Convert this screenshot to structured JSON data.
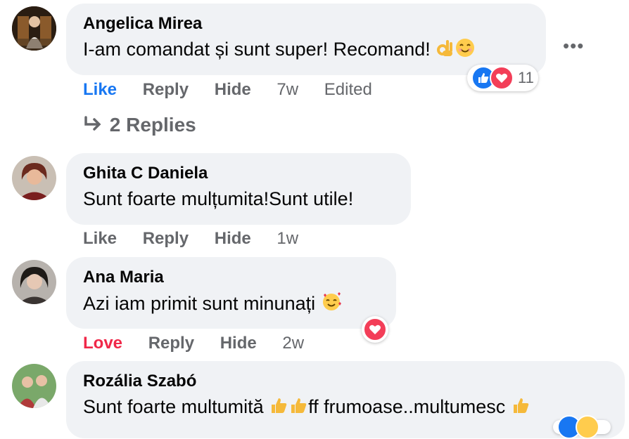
{
  "more_label": "•••",
  "comments": [
    {
      "author": "Angelica Mirea",
      "text": "I-am comandat și sunt super! Recomand!",
      "like": "Like",
      "reply": "Reply",
      "hide": "Hide",
      "time": "7w",
      "edited": "Edited",
      "reaction_count": "11",
      "replies_label": "2 Replies"
    },
    {
      "author": "Ghita C Daniela",
      "text": "Sunt foarte mulțumita!Sunt utile!",
      "like": "Like",
      "reply": "Reply",
      "hide": "Hide",
      "time": "1w"
    },
    {
      "author": "Ana Maria",
      "text": "Azi iam primit sunt minunați",
      "like": "Love",
      "reply": "Reply",
      "hide": "Hide",
      "time": "2w"
    },
    {
      "author": "Rozália Szabó",
      "text_part1": "Sunt foarte multumită",
      "text_part2": "ff frumoase..multumesc"
    }
  ],
  "colors": {
    "like_blue": "#1877f2",
    "love_red": "#f02849",
    "bubble_bg": "#f0f2f5",
    "meta_gray": "#65676b"
  }
}
